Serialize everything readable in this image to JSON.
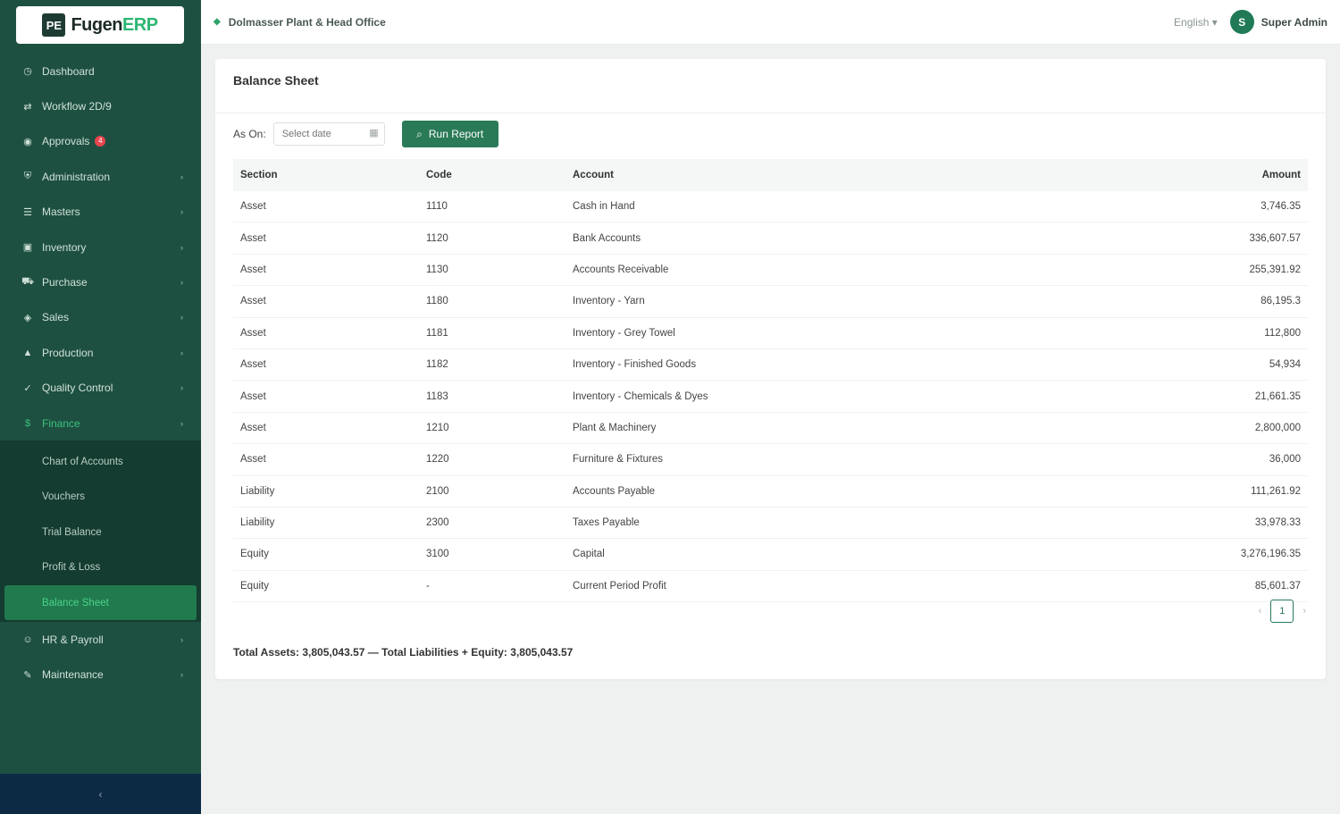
{
  "brand": {
    "logo_mark": "PE",
    "name": "Fugen",
    "suffix": "ERP"
  },
  "sidebar": {
    "items": [
      {
        "label": "Dashboard",
        "icon": "gauge-icon",
        "glyph": "◷",
        "chevron": false
      },
      {
        "label": "Workflow 2D/9",
        "icon": "workflow-icon",
        "glyph": "⇄",
        "chevron": false
      },
      {
        "label": "Approvals",
        "icon": "check-circle-icon",
        "glyph": "◉",
        "chevron": false,
        "badge": "4"
      },
      {
        "label": "Administration",
        "icon": "shield-icon",
        "glyph": "⛨",
        "chevron": true
      },
      {
        "label": "Masters",
        "icon": "database-icon",
        "glyph": "☰",
        "chevron": true
      },
      {
        "label": "Inventory",
        "icon": "box-icon",
        "glyph": "▣",
        "chevron": true
      },
      {
        "label": "Purchase",
        "icon": "cart-icon",
        "glyph": "⛟",
        "chevron": true
      },
      {
        "label": "Sales",
        "icon": "tag-icon",
        "glyph": "◈",
        "chevron": true
      },
      {
        "label": "Production",
        "icon": "factory-icon",
        "glyph": "▲",
        "chevron": true
      },
      {
        "label": "Quality Control",
        "icon": "badge-check-icon",
        "glyph": "✓",
        "chevron": true
      },
      {
        "label": "Finance",
        "icon": "finance-icon",
        "glyph": "$",
        "chevron": true,
        "active": true
      }
    ],
    "finance_submenu": [
      {
        "label": "Chart of Accounts"
      },
      {
        "label": "Vouchers"
      },
      {
        "label": "Trial Balance"
      },
      {
        "label": "Profit & Loss"
      },
      {
        "label": "Balance Sheet",
        "active": true
      }
    ],
    "items_after": [
      {
        "label": "HR & Payroll",
        "icon": "people-icon",
        "glyph": "☺",
        "chevron": true
      },
      {
        "label": "Maintenance",
        "icon": "wrench-icon",
        "glyph": "✎",
        "chevron": true
      }
    ],
    "collapse_glyph": "‹"
  },
  "header": {
    "org_name": "Dolmasser Plant & Head Office",
    "language": "English ▾",
    "user_initial": "S",
    "user_name": "Super Admin"
  },
  "report": {
    "title": "Balance Sheet",
    "as_of_label": "As On:",
    "date_placeholder": "Select date",
    "run_label": "Run Report",
    "columns": [
      "Section",
      "Code",
      "Account",
      "Amount"
    ],
    "rows": [
      {
        "section": "Asset",
        "code": "1110",
        "account": "Cash in Hand",
        "amount": "3,746.35"
      },
      {
        "section": "Asset",
        "code": "1120",
        "account": "Bank Accounts",
        "amount": "336,607.57"
      },
      {
        "section": "Asset",
        "code": "1130",
        "account": "Accounts Receivable",
        "amount": "255,391.92"
      },
      {
        "section": "Asset",
        "code": "1180",
        "account": "Inventory - Yarn",
        "amount": "86,195.3"
      },
      {
        "section": "Asset",
        "code": "1181",
        "account": "Inventory - Grey Towel",
        "amount": "112,800"
      },
      {
        "section": "Asset",
        "code": "1182",
        "account": "Inventory - Finished Goods",
        "amount": "54,934"
      },
      {
        "section": "Asset",
        "code": "1183",
        "account": "Inventory - Chemicals & Dyes",
        "amount": "21,661.35"
      },
      {
        "section": "Asset",
        "code": "1210",
        "account": "Plant & Machinery",
        "amount": "2,800,000"
      },
      {
        "section": "Asset",
        "code": "1220",
        "account": "Furniture & Fixtures",
        "amount": "36,000"
      },
      {
        "section": "Liability",
        "code": "2100",
        "account": "Accounts Payable",
        "amount": "111,261.92"
      },
      {
        "section": "Liability",
        "code": "2300",
        "account": "Taxes Payable",
        "amount": "33,978.33"
      },
      {
        "section": "Equity",
        "code": "3100",
        "account": "Capital",
        "amount": "3,276,196.35"
      },
      {
        "section": "Equity",
        "code": "-",
        "account": "Current Period Profit",
        "amount": "85,601.37"
      }
    ],
    "pager": {
      "prev": "‹",
      "current": "1",
      "next": "›"
    },
    "summary": {
      "assets_label": "Total Assets:",
      "assets_value": "3,805,043.57",
      "separator": "—",
      "liab_label": "Total Liabilities + Equity:",
      "liab_value": "3,805,043.57"
    }
  },
  "colors": {
    "sidebar": "#1e5042",
    "accent": "#2a7a58",
    "active_text": "#39c27b"
  }
}
